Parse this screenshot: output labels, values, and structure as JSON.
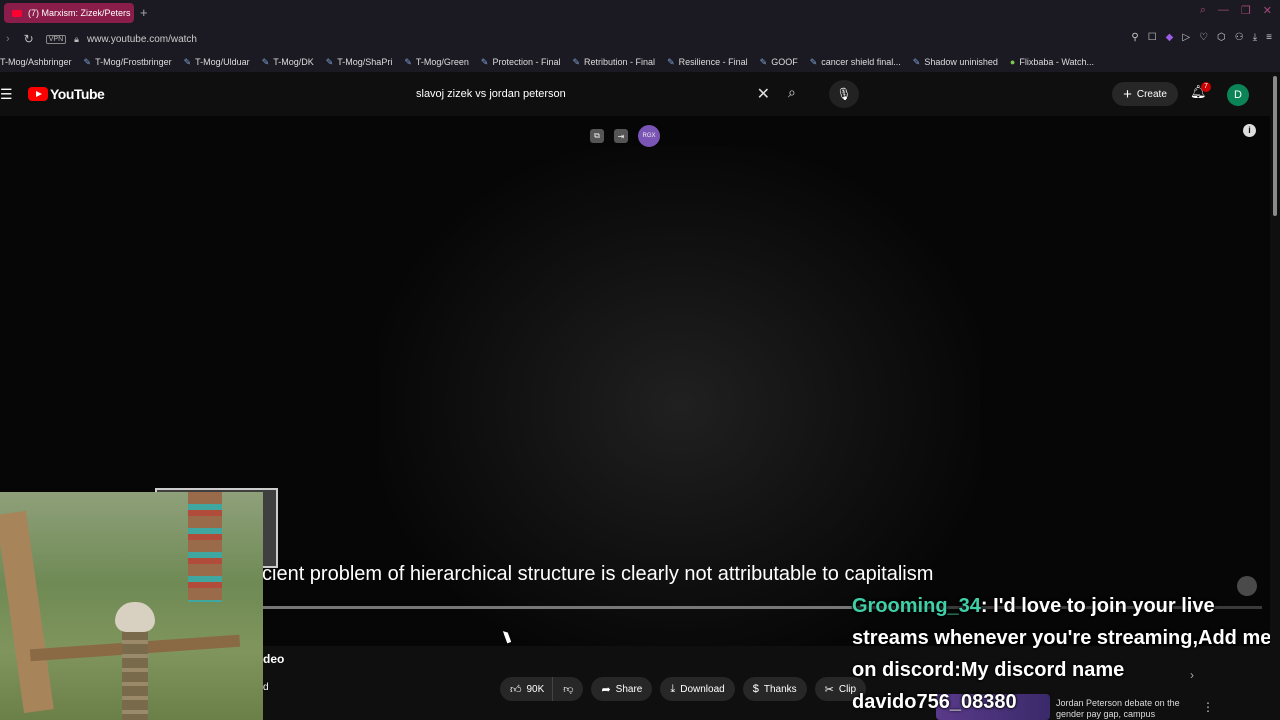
{
  "browser": {
    "tab_title": "(7) Marxism: Zizek/Peters",
    "new_tab": "+",
    "url": "www.youtube.com/watch",
    "vpn_label": "VPN"
  },
  "bookmarks": [
    {
      "label": "T-Mog/Ashbringer",
      "icon": "none"
    },
    {
      "label": "T-Mog/Frostbringer",
      "icon": "feather-icon"
    },
    {
      "label": "T-Mog/Ulduar",
      "icon": "feather-icon"
    },
    {
      "label": "T-Mog/DK",
      "icon": "feather-icon"
    },
    {
      "label": "T-Mog/ShaPri",
      "icon": "feather-icon"
    },
    {
      "label": "T-Mog/Green",
      "icon": "feather-icon"
    },
    {
      "label": "Protection - Final",
      "icon": "feather-icon"
    },
    {
      "label": "Retribution - Final",
      "icon": "feather-icon"
    },
    {
      "label": "Resilience - Final",
      "icon": "feather-icon"
    },
    {
      "label": "GOOF",
      "icon": "feather-icon"
    },
    {
      "label": "cancer shield final...",
      "icon": "feather-icon"
    },
    {
      "label": "Shadow uninished",
      "icon": "feather-icon"
    },
    {
      "label": "Flixbaba - Watch...",
      "icon": "android-icon"
    }
  ],
  "youtube": {
    "logo_text": "YouTube",
    "search_value": "slavoj zizek vs jordan peterson",
    "create_label": "Create",
    "notif_count": "7",
    "avatar_letter": "D"
  },
  "video": {
    "caption": "cient problem of hierarchical structure is clearly not attributable to capitalism",
    "ext_rgx": "RGX",
    "title_fragment": "deo",
    "subscribed_fragment": "d"
  },
  "actions": {
    "likes": "90K",
    "share": "Share",
    "download": "Download",
    "thanks": "Thanks",
    "clip": "Clip"
  },
  "chat": {
    "user": "Grooming_34",
    "message": ": I'd love to join your live streams whenever you're streaming,Add me on discord:My discord name davido756_08380"
  },
  "recommendation": {
    "title": "Jordan Peterson debate on the gender pay gap, campus"
  }
}
